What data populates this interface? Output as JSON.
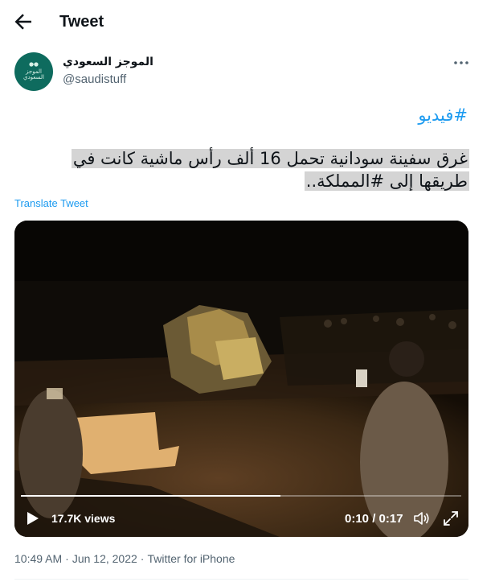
{
  "header": {
    "title": "Tweet"
  },
  "author": {
    "display_name": "الموجز السعودي",
    "handle": "@saudistuff",
    "avatar_text": "الموجز السعودي",
    "avatar_color": "#0e6b5e"
  },
  "tweet": {
    "hashtag": "#فيديو",
    "text": "غرق سفينة سودانية تحمل 16 ألف رأس ماشية كانت في طريقها إلى #المملكة..",
    "translate_label": "Translate Tweet"
  },
  "video": {
    "views": "17.7K views",
    "time": "0:10 / 0:17",
    "progress_fraction": 0.59
  },
  "footer": {
    "time": "10:49 AM",
    "date": "Jun 12, 2022",
    "source": "Twitter for iPhone",
    "separator": "·"
  },
  "colors": {
    "accent": "#1d9bf0",
    "secondary_text": "#536471",
    "primary_text": "#0f1419"
  },
  "icons": [
    "back-arrow-icon",
    "more-icon",
    "play-icon",
    "volume-icon",
    "fullscreen-icon"
  ]
}
